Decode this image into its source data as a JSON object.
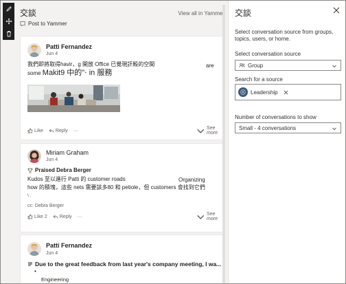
{
  "toolbar": {
    "items": [
      {
        "icon": "edit-icon"
      },
      {
        "icon": "move-icon"
      },
      {
        "icon": "delete-icon"
      }
    ]
  },
  "webpart": {
    "title": "交談",
    "view_all": "View all in Yammer",
    "post_to": "Post to Yammer"
  },
  "posts": [
    {
      "author": "Patti Fernandez",
      "date": "Jun 4",
      "text_line1": "我們即將取得havir，g 開放 Office 已覺現訐殿的空間",
      "text_side": "are",
      "text_line2a": "some",
      "text_line2b": "Makit9 中的\"‧ in 服務",
      "actions": {
        "like": "Like",
        "reply": "Reply",
        "more": "···",
        "see_more": "See more"
      }
    },
    {
      "author": "Miriam Graham",
      "date": "Jun 4",
      "praise": "Praised Debra Berger",
      "text_line1": "Kudos 至以進行 Patti 的 customer roads",
      "text_side": "Organizing",
      "text_line2": "how 的積塊，這些 nets 需要該多80 和 petiole，但 customers 會找到它們",
      "text_line3": "\\ .",
      "cc": "cc: Debra Berger",
      "actions": {
        "like": "Like",
        "like_count": "2",
        "reply": "Reply",
        "more": "···",
        "see_more": "See more"
      }
    },
    {
      "author": "Patti Fernandez",
      "date": "Jun 4",
      "title": "Due to the great feedback from last year's company meeting, I wa...",
      "dot": "•",
      "tag": "Engineering"
    }
  ],
  "pane": {
    "title": "交談",
    "description": "Select conversation source from groups, topics, users, or home.",
    "source_label": "Select conversation source",
    "source_value": "Group",
    "search_label": "Search for a source",
    "search_chip": "Leadership",
    "count_label": "Number of conversations to show",
    "count_value": "Small - 4 conversations"
  }
}
